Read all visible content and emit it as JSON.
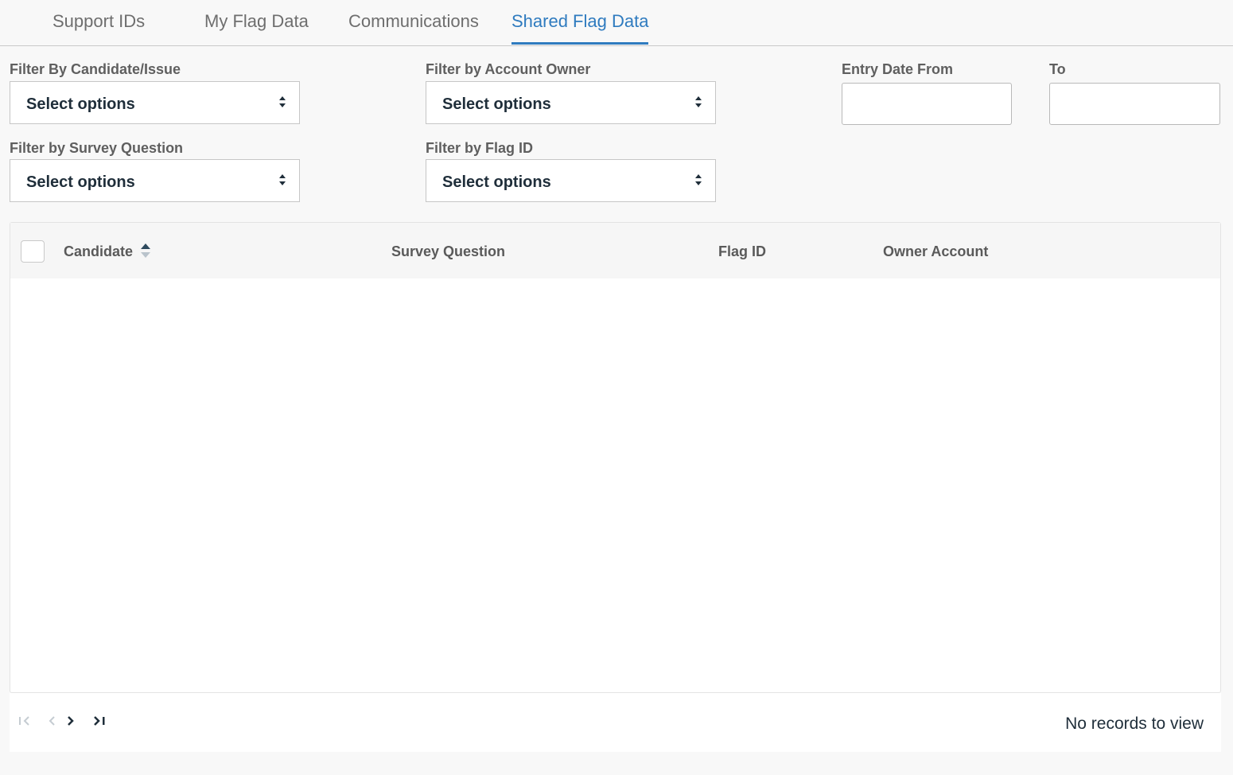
{
  "tabs": [
    {
      "label": "Support IDs",
      "active": false
    },
    {
      "label": "My Flag Data",
      "active": false
    },
    {
      "label": "Communications",
      "active": false
    },
    {
      "label": "Shared Flag Data",
      "active": true
    }
  ],
  "filters": {
    "candidate": {
      "label": "Filter By Candidate/Issue",
      "value": "Select options"
    },
    "account_owner": {
      "label": "Filter by Account Owner",
      "value": "Select options"
    },
    "survey_question": {
      "label": "Filter by Survey Question",
      "value": "Select options"
    },
    "flag_id": {
      "label": "Filter by Flag ID",
      "value": "Select options"
    },
    "entry_date_from": {
      "label": "Entry Date From",
      "value": ""
    },
    "entry_date_to": {
      "label": "To",
      "value": ""
    }
  },
  "table": {
    "columns": [
      "Candidate",
      "Survey Question",
      "Flag ID",
      "Owner Account"
    ],
    "rows": []
  },
  "pager": {
    "status": "No records to view"
  },
  "colors": {
    "accent": "#2f7bbf",
    "text_dark": "#1f2e3a",
    "label": "#5f5f5f"
  },
  "icons": {
    "sort": "sort-asc-icon",
    "select": "select-arrows-icon",
    "first": "first-page-icon",
    "prev": "prev-page-icon",
    "next": "next-page-icon",
    "last": "last-page-icon"
  }
}
